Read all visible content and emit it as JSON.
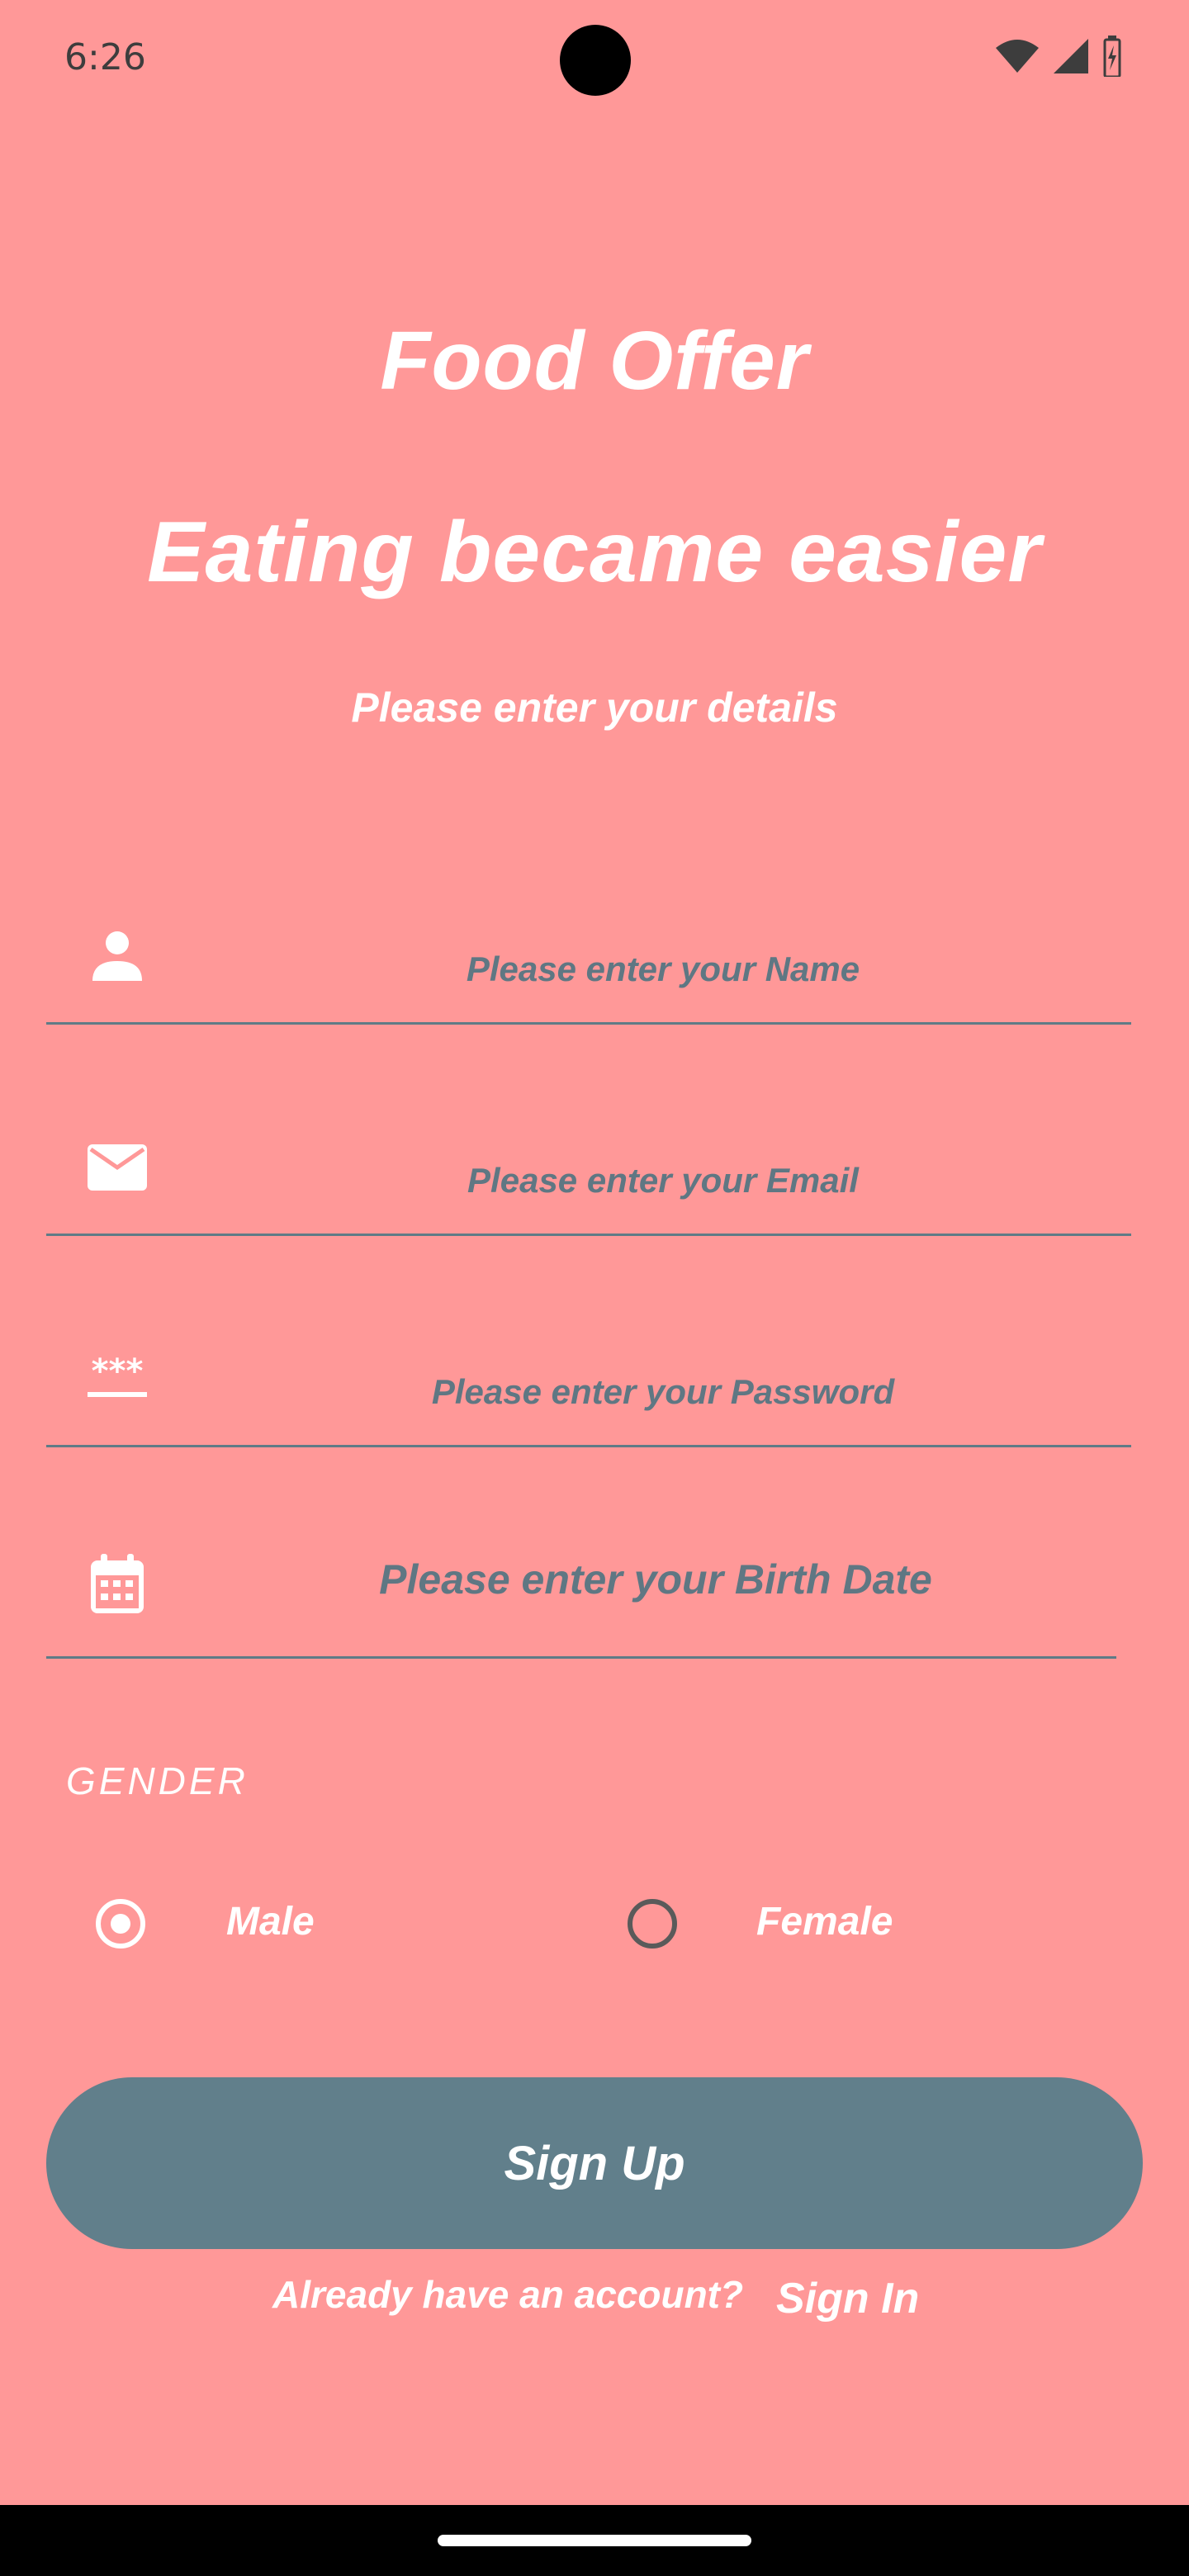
{
  "status_bar": {
    "time": "6:26",
    "icons": [
      "wifi-icon",
      "signal-icon",
      "battery-icon"
    ]
  },
  "header": {
    "title": "Food Offer",
    "tagline": "Eating became easier",
    "subtitle": "Please enter your details"
  },
  "form": {
    "name_placeholder": "Please enter your Name",
    "email_placeholder": "Please enter your Email",
    "password_placeholder": "Please enter your Password",
    "birthdate_placeholder": "Please enter your Birth Date",
    "gender_label": "GENDER",
    "gender_options": [
      {
        "label": "Male",
        "selected": true
      },
      {
        "label": "Female",
        "selected": false
      }
    ],
    "signup_label": "Sign Up",
    "already_text": "Already have an account?",
    "signin_label": "Sign In"
  },
  "colors": {
    "background": "#FF9898",
    "accent": "#617F8B",
    "hint_text": "#5F7783"
  }
}
